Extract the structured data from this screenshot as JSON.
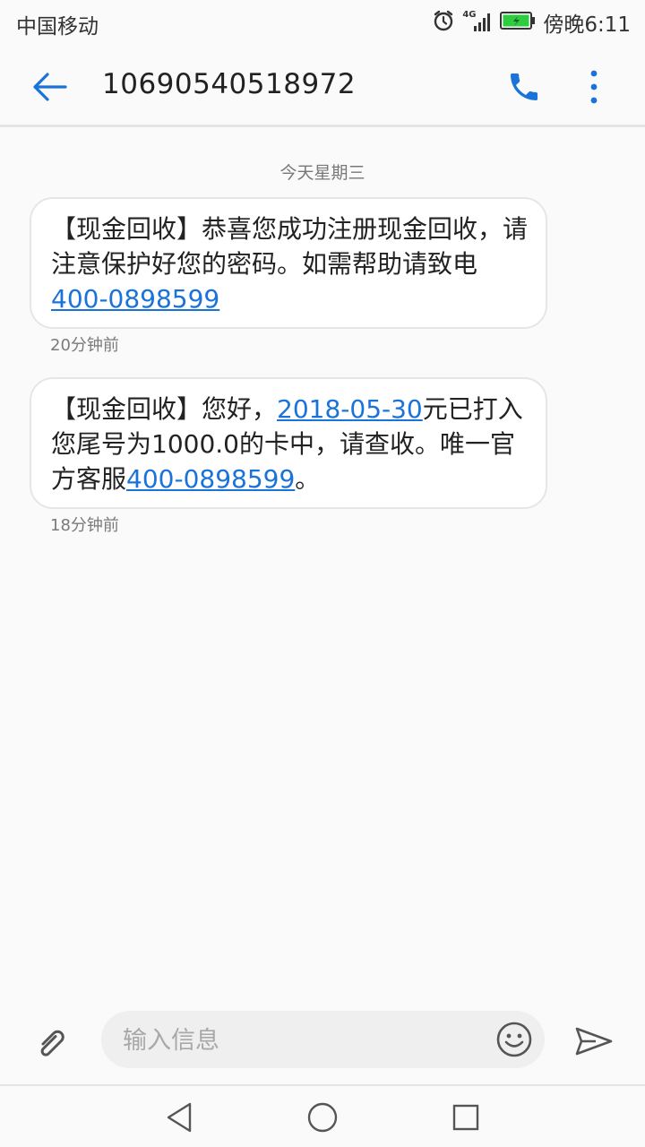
{
  "status_bar": {
    "carrier": "中国移动",
    "network": "4G",
    "time": "傍晚6:11"
  },
  "header": {
    "contact_number": "10690540518972"
  },
  "conversation": {
    "date_separator": "今天星期三",
    "messages": [
      {
        "text_before": "【现金回收】恭喜您成功注册现金回收，请注意保护好您的密码。如需帮助请致电",
        "link": "400-0898599",
        "text_after": "",
        "time": "20分钟前"
      },
      {
        "text_before": "【现金回收】您好，",
        "link1": "2018-05-30",
        "text_middle": "元已打入您尾号为1000.0的卡中，请查收。唯一官方客服",
        "link2": "400-0898599",
        "text_after": "。",
        "time": "18分钟前"
      }
    ]
  },
  "composer": {
    "placeholder": "输入信息"
  },
  "colors": {
    "accent": "#1a73d9",
    "battery": "#2ecc40"
  },
  "icons": [
    "back-arrow-icon",
    "phone-icon",
    "more-vertical-icon",
    "paperclip-icon",
    "emoji-icon",
    "send-icon",
    "alarm-icon",
    "signal-icon",
    "battery-icon",
    "nav-back-icon",
    "nav-home-icon",
    "nav-recents-icon"
  ]
}
